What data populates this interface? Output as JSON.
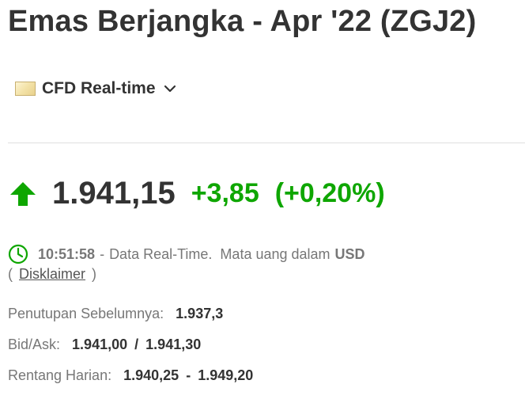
{
  "header": {
    "title": "Emas Berjangka - Apr '22 (ZGJ2)"
  },
  "source": {
    "label": "CFD Real-time",
    "icon": "flag-icon"
  },
  "quote": {
    "last": "1.941,15",
    "change": "+3,85",
    "change_percent": "(+0,20%)",
    "direction": "up",
    "up_color": "#0ea600"
  },
  "status": {
    "time": "10:51:58",
    "separator": "-",
    "description": "Data Real-Time.  Mata uang dalam",
    "currency": "USD",
    "disclaimer_open": "(",
    "disclaimer_label": "Disklaimer",
    "disclaimer_close": ")"
  },
  "details": {
    "prev_close_label": "Penutupan Sebelumnya:",
    "prev_close_value": "1.937,3",
    "bid_ask_label": "Bid/Ask:",
    "bid_value": "1.941,00",
    "bid_ask_separator": "/",
    "ask_value": "1.941,30",
    "day_range_label": "Rentang Harian:",
    "day_range_low": "1.940,25",
    "day_range_separator": "-",
    "day_range_high": "1.949,20"
  }
}
